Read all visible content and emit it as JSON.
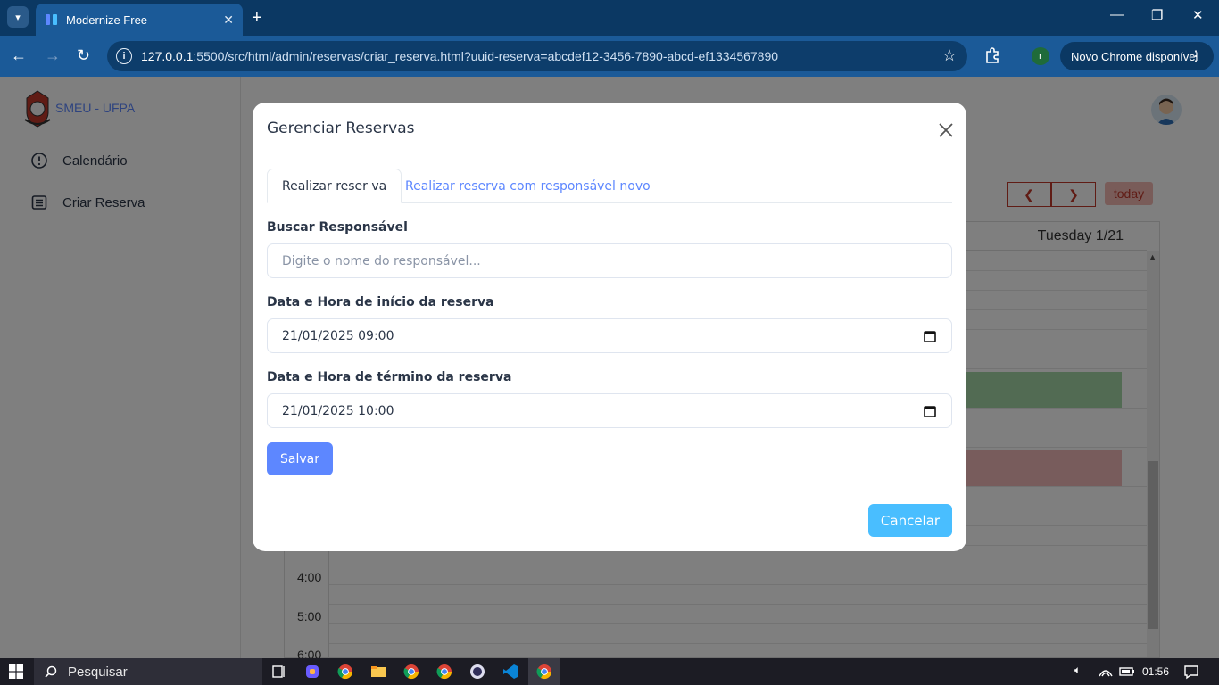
{
  "browser": {
    "tab_title": "Modernize Free",
    "url_host": "127.0.0.1",
    "url_rest": ":5500/src/html/admin/reservas/criar_reserva.html?uuid-reserva=abcdef12-3456-7890-abcd-ef1334567890",
    "profile_initial": "r",
    "update_label": "Novo Chrome disponível"
  },
  "sidebar": {
    "brand": "SMEU - UFPA",
    "items": [
      {
        "label": "Calendário",
        "icon": "alert-circle-icon"
      },
      {
        "label": "Criar Reserva",
        "icon": "list-icon"
      }
    ]
  },
  "calendar": {
    "day_header": "Tuesday 1/21",
    "today_label": "today",
    "prev_label": "❮",
    "next_label": "❯",
    "times": [
      "4:00",
      "5:00",
      "6:00"
    ],
    "event_colors": [
      "#a5d6a7",
      "#f0b8b8"
    ]
  },
  "modal": {
    "title": "Gerenciar Reservas",
    "tabs": [
      {
        "label": "Realizar reser va",
        "active": true
      },
      {
        "label": "Realizar reserva com responsável novo",
        "active": false
      }
    ],
    "search_label": "Buscar Responsável",
    "search_placeholder": "Digite o nome do responsável...",
    "start_label": "Data e Hora de início da reserva",
    "start_value": "21/01/2025 09:00",
    "end_label": "Data e Hora de término da reserva",
    "end_value": "21/01/2025 10:00",
    "save_label": "Salvar",
    "cancel_label": "Cancelar"
  },
  "taskbar": {
    "search_label": "Pesquisar",
    "time": "01:56"
  },
  "colors": {
    "primary": "#5d87ff",
    "info": "#49beff",
    "chrome_blue": "#1b5a98"
  }
}
